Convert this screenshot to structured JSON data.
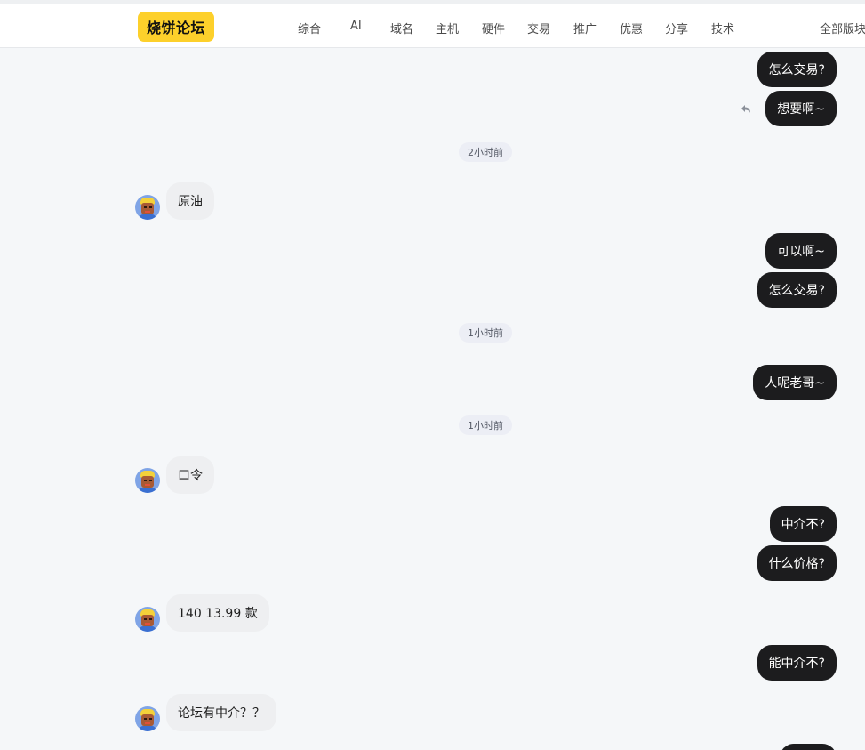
{
  "header": {
    "logo": "烧饼论坛",
    "nav": [
      "综合",
      "AI",
      "域名",
      "主机",
      "硬件",
      "交易",
      "推广",
      "优惠",
      "分享",
      "技术"
    ],
    "all_sections": "全部版块"
  },
  "messages": [
    {
      "dir": "out",
      "text": "怎么交易?"
    },
    {
      "dir": "out",
      "text": "想要啊~"
    },
    {
      "dir": "time",
      "text": "2小时前"
    },
    {
      "dir": "in",
      "text": "原油"
    },
    {
      "dir": "out",
      "text": "可以啊~"
    },
    {
      "dir": "out",
      "text": "怎么交易?"
    },
    {
      "dir": "time",
      "text": "1小时前"
    },
    {
      "dir": "out",
      "text": "人呢老哥~"
    },
    {
      "dir": "time",
      "text": "1小时前"
    },
    {
      "dir": "in",
      "text": "口令"
    },
    {
      "dir": "out",
      "text": "中介不?"
    },
    {
      "dir": "out",
      "text": "什么价格?"
    },
    {
      "dir": "in",
      "text": "140 13.99 款"
    },
    {
      "dir": "out",
      "text": "能中介不?"
    },
    {
      "dir": "in",
      "text": "论坛有中介？？"
    }
  ],
  "icons": {
    "reply": "reply-arrow-icon",
    "avatar": "user-avatar"
  }
}
